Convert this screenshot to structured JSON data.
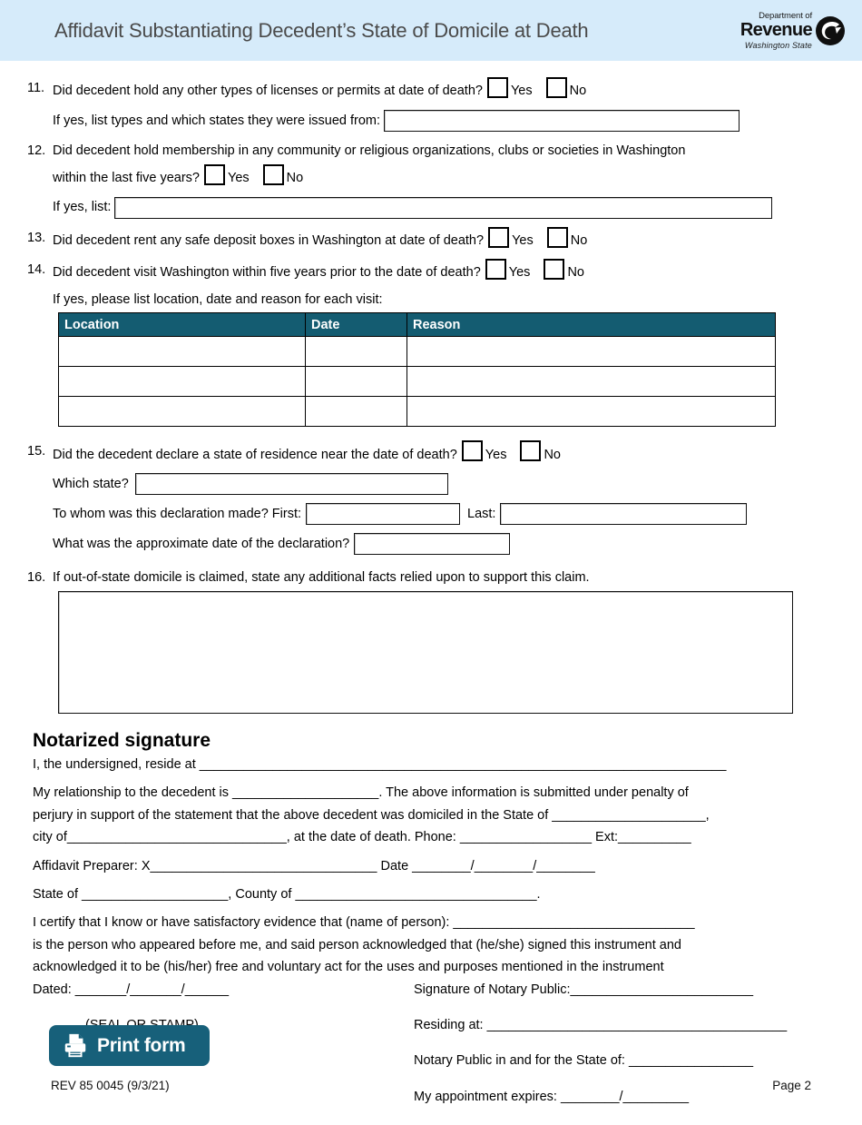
{
  "header": {
    "title": "Affidavit Substantiating Decedent’s State of Domicile at Death",
    "logo": {
      "line1": "Department of",
      "line2": "Revenue",
      "line3": "Washington State"
    },
    "band_color": "#d6ebfa",
    "title_color": "#4a4a4a"
  },
  "questions": {
    "q11": {
      "number": "11.",
      "text": "Did decedent hold any other types of licenses or permits at date of death?",
      "yes": "Yes",
      "no": "No",
      "followup_label": "If yes, list types and which states they were issued from:",
      "followup_value": ""
    },
    "q12": {
      "number": "12.",
      "text_line1": "Did decedent hold membership in any community or religious organizations, clubs or societies in Washington",
      "text_line2": "within the last five years?",
      "yes": "Yes",
      "no": "No",
      "followup_label": "If yes, list:",
      "followup_value": ""
    },
    "q13": {
      "number": "13.",
      "text": "Did decedent rent any safe deposit boxes in Washington at date of death?",
      "yes": "Yes",
      "no": "No"
    },
    "q14": {
      "number": "14.",
      "text": "Did decedent visit Washington within five years prior to the date of death?",
      "yes": "Yes",
      "no": "No",
      "followup_label": "If yes, please list location, date and reason for each visit:",
      "table": {
        "headers": [
          "Location",
          "Date",
          "Reason"
        ],
        "rows": [
          [
            "",
            "",
            ""
          ],
          [
            "",
            "",
            ""
          ],
          [
            "",
            "",
            ""
          ]
        ]
      }
    },
    "q15": {
      "number": "15.",
      "text": "Did the decedent declare a state of residence near the date of death?",
      "yes": "Yes",
      "no": "No",
      "which_state_label": "Which state?",
      "which_state_value": "",
      "to_whom_label": "To whom was this declaration made? First:",
      "first_value": "",
      "last_label": "Last:",
      "last_value": "",
      "approx_date_label": "What was the approximate date of the declaration?",
      "approx_date_value": ""
    },
    "q16": {
      "number": "16.",
      "text": "If out-of-state domicile is claimed, state any additional facts relied upon to support this claim.",
      "value": ""
    }
  },
  "notary": {
    "heading": "Notarized signature",
    "line_reside": "I, the undersigned, reside at ________________________________________________________________________",
    "line_relationship": "My relationship to the decedent is ____________________. The above information is submitted under penalty of",
    "line_perjury": "perjury in support of the statement that the above decedent was domiciled in the State of _____________________,",
    "line_city": "city of______________________________, at the date of death.     Phone: __________________     Ext:__________",
    "line_preparer": "Affidavit Preparer: X_______________________________          Date ________/________/________",
    "line_state_county": "State of ____________________, County of _________________________________.",
    "line_certify": "I certify that I know or have satisfactory evidence that (name of person): _________________________________",
    "line_appeared": "is the person who appeared before me, and said person acknowledged that (he/she) signed this instrument and",
    "line_acknowledged": "acknowledged it to be (his/her) free and voluntary act for the uses and purposes mentioned in the instrument",
    "line_dated": "Dated: _______/_______/______",
    "line_seal": "(SEAL OR STAMP)",
    "line_signature": "Signature of Notary Public:_________________________",
    "line_residing": "Residing at: _________________________________________",
    "line_state_of": "Notary Public in and for the State of: _________________",
    "line_expires": "My appointment expires: ________/_________"
  },
  "print_button": {
    "label": "Print form",
    "icon": "printer-icon",
    "color": "#17607a"
  },
  "footer": {
    "revision": "REV 85 0045 (9/3/21)",
    "page": "Page 2"
  },
  "colors": {
    "table_header": "#145c71",
    "header_band": "#d6ebfa",
    "button": "#17607a"
  }
}
